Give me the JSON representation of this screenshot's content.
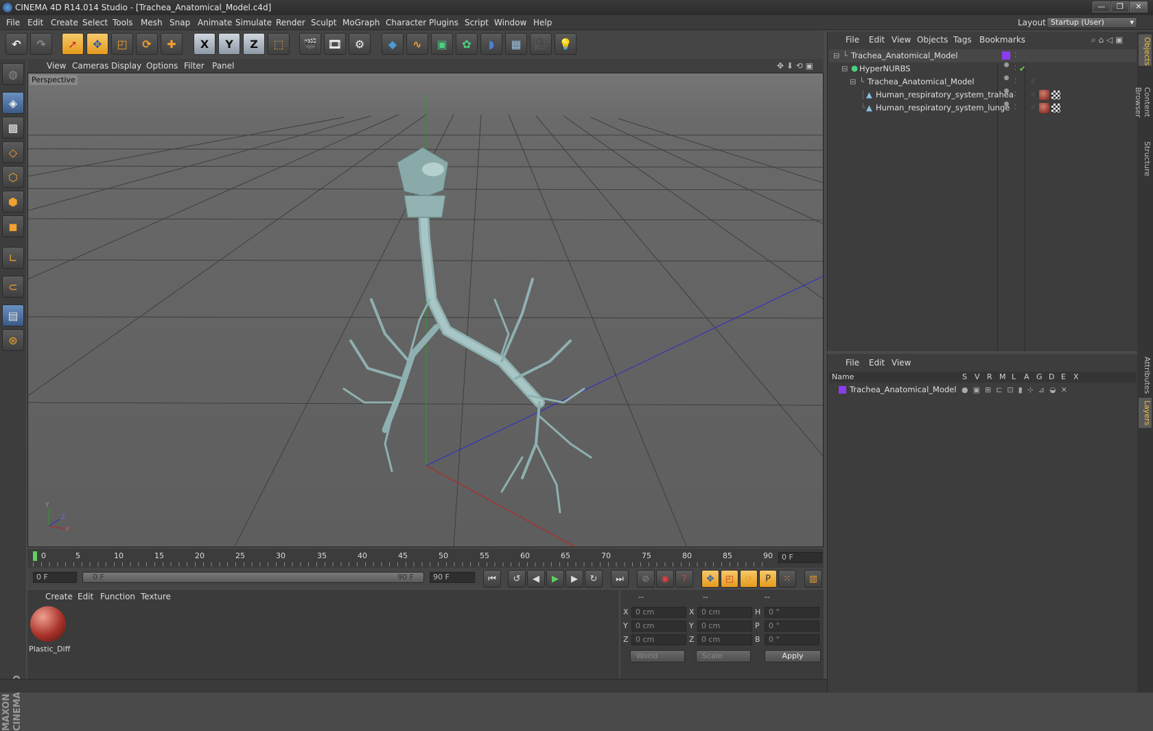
{
  "window": {
    "title": "CINEMA 4D R14.014 Studio - [Trachea_Anatomical_Model.c4d]",
    "buttons": [
      "—",
      "❐",
      "✕"
    ]
  },
  "menubar": {
    "items": [
      "File",
      "Edit",
      "Create",
      "Select",
      "Tools",
      "Mesh",
      "Snap",
      "Animate",
      "Simulate",
      "Render",
      "Sculpt",
      "MoGraph",
      "Character",
      "Plugins",
      "Script",
      "Window",
      "Help"
    ],
    "layout_label": "Layout:",
    "layout_value": "Startup (User)"
  },
  "toolbar": {
    "axis_labels": [
      "X",
      "Y",
      "Z"
    ]
  },
  "viewport": {
    "menu": [
      "View",
      "Cameras",
      "Display",
      "Options",
      "Filter",
      "Panel"
    ],
    "camera_label": "Perspective",
    "axis_labels": {
      "x": "X",
      "y": "Y",
      "z": "Z"
    }
  },
  "timeline": {
    "ticks": [
      "0",
      "5",
      "10",
      "15",
      "20",
      "25",
      "30",
      "35",
      "40",
      "45",
      "50",
      "55",
      "60",
      "65",
      "70",
      "75",
      "80",
      "85",
      "90"
    ],
    "current_frame": "0 F",
    "start_field": "0 F",
    "range_start": "0 F",
    "range_end": "90 F",
    "end_field": "90 F"
  },
  "material_manager": {
    "menu": [
      "Create",
      "Edit",
      "Function",
      "Texture"
    ],
    "materials": [
      {
        "name": "Plastic_Diff"
      }
    ]
  },
  "coordinates": {
    "headers": [
      "--",
      "--",
      "--"
    ],
    "rows": [
      {
        "a": "X",
        "av": "0 cm",
        "b": "X",
        "bv": "0 cm",
        "c": "H",
        "cv": "0 °"
      },
      {
        "a": "Y",
        "av": "0 cm",
        "b": "Y",
        "bv": "0 cm",
        "c": "P",
        "cv": "0 °"
      },
      {
        "a": "Z",
        "av": "0 cm",
        "b": "Z",
        "bv": "0 cm",
        "c": "B",
        "cv": "0 °"
      }
    ],
    "mode_select": "World",
    "size_select": "Scale",
    "apply_label": "Apply"
  },
  "object_manager": {
    "menu": [
      "File",
      "Edit",
      "View",
      "Objects",
      "Tags",
      "Bookmarks"
    ],
    "objects": [
      {
        "name": "Trachea_Anatomical_Model"
      },
      {
        "name": "HyperNURBS"
      },
      {
        "name": "Trachea_Anatomical_Model"
      },
      {
        "name": "Human_respiratory_system_trahea"
      },
      {
        "name": "Human_respiratory_system_lunge"
      }
    ],
    "colors": {
      "layer": "#8a3df0",
      "check": "#6fd34a"
    }
  },
  "layer_manager": {
    "menu": [
      "File",
      "Edit",
      "View"
    ],
    "columns": [
      "Name",
      "S",
      "V",
      "R",
      "M",
      "L",
      "A",
      "G",
      "D",
      "E",
      "X"
    ],
    "layers": [
      {
        "name": "Trachea_Anatomical_Model"
      }
    ]
  },
  "right_tabs": [
    "Objects",
    "Content Browser",
    "Structure",
    "Attributes",
    "Layers"
  ]
}
